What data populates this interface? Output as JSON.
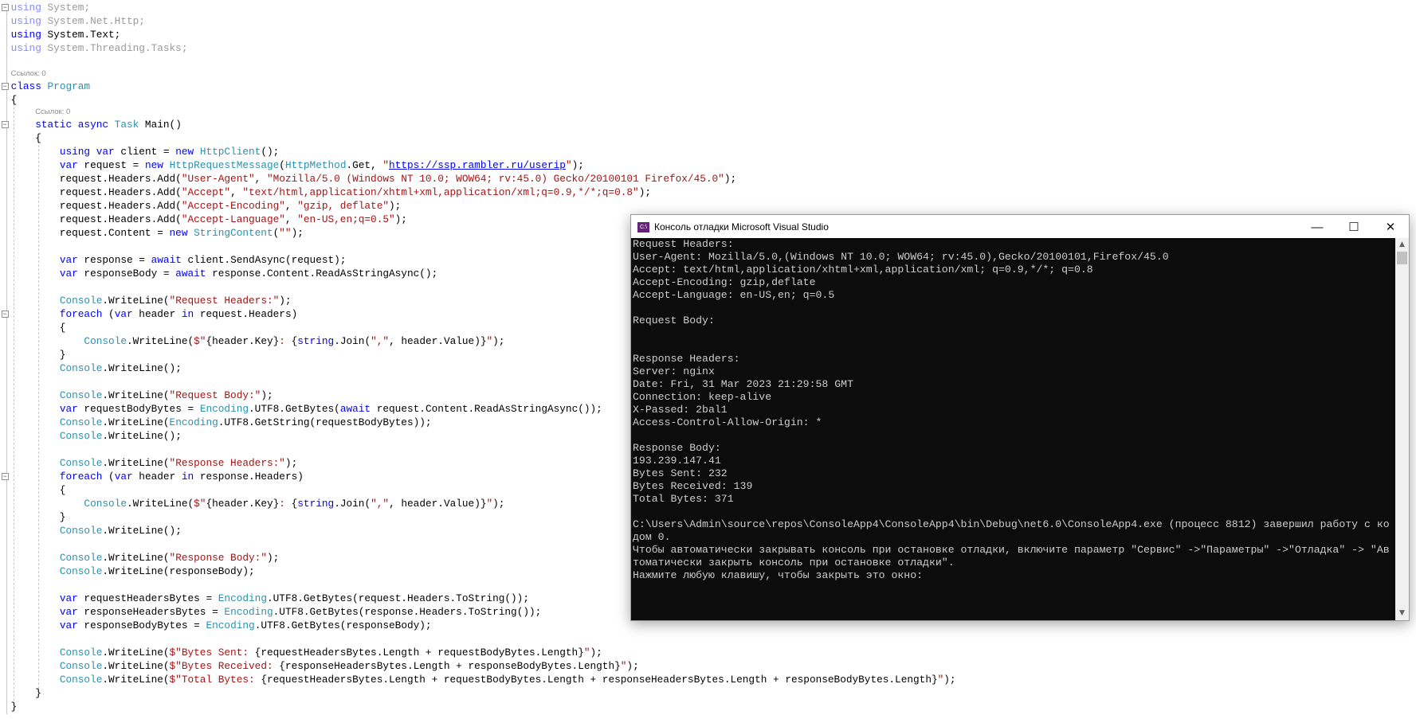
{
  "code": {
    "lines": [
      {
        "fold": true,
        "tokens": [
          [
            "fk",
            "using"
          ],
          [
            "f",
            " System;"
          ]
        ]
      },
      {
        "tokens": [
          [
            "fk",
            "using"
          ],
          [
            "f",
            " System.Net.Http;"
          ]
        ]
      },
      {
        "tokens": [
          [
            "k",
            "using"
          ],
          [
            "p",
            " System.Text;"
          ]
        ]
      },
      {
        "tokens": [
          [
            "fk",
            "using"
          ],
          [
            "f",
            " System.Threading.Tasks;"
          ]
        ]
      },
      {
        "tokens": []
      },
      {
        "lens": "Ссылок: 0",
        "indent": 0
      },
      {
        "fold": true,
        "tokens": [
          [
            "k",
            "class"
          ],
          [
            "p",
            " "
          ],
          [
            "t",
            "Program"
          ]
        ]
      },
      {
        "tokens": [
          [
            "p",
            "{"
          ]
        ]
      },
      {
        "lens": "Ссылок: 0",
        "indent": 4
      },
      {
        "fold": true,
        "tokens": [
          [
            "p",
            "    "
          ],
          [
            "k",
            "static async "
          ],
          [
            "t",
            "Task"
          ],
          [
            "p",
            " Main()"
          ]
        ]
      },
      {
        "tokens": [
          [
            "p",
            "    {"
          ]
        ]
      },
      {
        "tokens": [
          [
            "p",
            "        "
          ],
          [
            "k",
            "using var"
          ],
          [
            "p",
            " client = "
          ],
          [
            "k",
            "new "
          ],
          [
            "t",
            "HttpClient"
          ],
          [
            "p",
            "();"
          ]
        ]
      },
      {
        "tokens": [
          [
            "p",
            "        "
          ],
          [
            "k",
            "var"
          ],
          [
            "p",
            " request = "
          ],
          [
            "k",
            "new "
          ],
          [
            "t",
            "HttpRequestMessage"
          ],
          [
            "p",
            "("
          ],
          [
            "t",
            "HttpMethod"
          ],
          [
            "p",
            ".Get, "
          ],
          [
            "s",
            "\""
          ],
          [
            "u",
            "https://ssp.rambler.ru/userip"
          ],
          [
            "s",
            "\""
          ],
          [
            "p",
            ");"
          ]
        ]
      },
      {
        "tokens": [
          [
            "p",
            "        request.Headers.Add("
          ],
          [
            "s",
            "\"User-Agent\""
          ],
          [
            "p",
            ", "
          ],
          [
            "s",
            "\"Mozilla/5.0 (Windows NT 10.0; WOW64; rv:45.0) Gecko/20100101 Firefox/45.0\""
          ],
          [
            "p",
            ");"
          ]
        ]
      },
      {
        "tokens": [
          [
            "p",
            "        request.Headers.Add("
          ],
          [
            "s",
            "\"Accept\""
          ],
          [
            "p",
            ", "
          ],
          [
            "s",
            "\"text/html,application/xhtml+xml,application/xml;q=0.9,*/*;q=0.8\""
          ],
          [
            "p",
            ");"
          ]
        ]
      },
      {
        "tokens": [
          [
            "p",
            "        request.Headers.Add("
          ],
          [
            "s",
            "\"Accept-Encoding\""
          ],
          [
            "p",
            ", "
          ],
          [
            "s",
            "\"gzip, deflate\""
          ],
          [
            "p",
            ");"
          ]
        ]
      },
      {
        "tokens": [
          [
            "p",
            "        request.Headers.Add("
          ],
          [
            "s",
            "\"Accept-Language\""
          ],
          [
            "p",
            ", "
          ],
          [
            "s",
            "\"en-US,en;q=0.5\""
          ],
          [
            "p",
            ");"
          ]
        ]
      },
      {
        "tokens": [
          [
            "p",
            "        request.Content = "
          ],
          [
            "k",
            "new "
          ],
          [
            "t",
            "StringContent"
          ],
          [
            "p",
            "("
          ],
          [
            "s",
            "\"\""
          ],
          [
            "p",
            ");"
          ]
        ]
      },
      {
        "tokens": []
      },
      {
        "tokens": [
          [
            "p",
            "        "
          ],
          [
            "k",
            "var"
          ],
          [
            "p",
            " response = "
          ],
          [
            "k",
            "await"
          ],
          [
            "p",
            " client.SendAsync(request);"
          ]
        ]
      },
      {
        "tokens": [
          [
            "p",
            "        "
          ],
          [
            "k",
            "var"
          ],
          [
            "p",
            " responseBody = "
          ],
          [
            "k",
            "await"
          ],
          [
            "p",
            " response.Content.ReadAsStringAsync();"
          ]
        ]
      },
      {
        "tokens": []
      },
      {
        "tokens": [
          [
            "p",
            "        "
          ],
          [
            "t",
            "Console"
          ],
          [
            "p",
            ".WriteLine("
          ],
          [
            "s",
            "\"Request Headers:\""
          ],
          [
            "p",
            ");"
          ]
        ]
      },
      {
        "fold": true,
        "tokens": [
          [
            "p",
            "        "
          ],
          [
            "k",
            "foreach"
          ],
          [
            "p",
            " ("
          ],
          [
            "k",
            "var"
          ],
          [
            "p",
            " header "
          ],
          [
            "k",
            "in"
          ],
          [
            "p",
            " request.Headers)"
          ]
        ]
      },
      {
        "tokens": [
          [
            "p",
            "        {"
          ]
        ]
      },
      {
        "tokens": [
          [
            "p",
            "            "
          ],
          [
            "t",
            "Console"
          ],
          [
            "p",
            ".WriteLine("
          ],
          [
            "s",
            "$\""
          ],
          [
            "p",
            "{header.Key}"
          ],
          [
            "s",
            ": "
          ],
          [
            "p",
            "{"
          ],
          [
            "k",
            "string"
          ],
          [
            "p",
            ".Join("
          ],
          [
            "s",
            "\",\""
          ],
          [
            "p",
            ", header.Value)}"
          ],
          [
            "s",
            "\""
          ],
          [
            "p",
            ");"
          ]
        ]
      },
      {
        "tokens": [
          [
            "p",
            "        }"
          ]
        ]
      },
      {
        "tokens": [
          [
            "p",
            "        "
          ],
          [
            "t",
            "Console"
          ],
          [
            "p",
            ".WriteLine();"
          ]
        ]
      },
      {
        "tokens": []
      },
      {
        "tokens": [
          [
            "p",
            "        "
          ],
          [
            "t",
            "Console"
          ],
          [
            "p",
            ".WriteLine("
          ],
          [
            "s",
            "\"Request Body:\""
          ],
          [
            "p",
            ");"
          ]
        ]
      },
      {
        "tokens": [
          [
            "p",
            "        "
          ],
          [
            "k",
            "var"
          ],
          [
            "p",
            " requestBodyBytes = "
          ],
          [
            "t",
            "Encoding"
          ],
          [
            "p",
            ".UTF8.GetBytes("
          ],
          [
            "k",
            "await"
          ],
          [
            "p",
            " request.Content.ReadAsStringAsync());"
          ]
        ]
      },
      {
        "tokens": [
          [
            "p",
            "        "
          ],
          [
            "t",
            "Console"
          ],
          [
            "p",
            ".WriteLine("
          ],
          [
            "t",
            "Encoding"
          ],
          [
            "p",
            ".UTF8.GetString(requestBodyBytes));"
          ]
        ]
      },
      {
        "tokens": [
          [
            "p",
            "        "
          ],
          [
            "t",
            "Console"
          ],
          [
            "p",
            ".WriteLine();"
          ]
        ]
      },
      {
        "tokens": []
      },
      {
        "tokens": [
          [
            "p",
            "        "
          ],
          [
            "t",
            "Console"
          ],
          [
            "p",
            ".WriteLine("
          ],
          [
            "s",
            "\"Response Headers:\""
          ],
          [
            "p",
            ");"
          ]
        ]
      },
      {
        "fold": true,
        "tokens": [
          [
            "p",
            "        "
          ],
          [
            "k",
            "foreach"
          ],
          [
            "p",
            " ("
          ],
          [
            "k",
            "var"
          ],
          [
            "p",
            " header "
          ],
          [
            "k",
            "in"
          ],
          [
            "p",
            " response.Headers)"
          ]
        ]
      },
      {
        "tokens": [
          [
            "p",
            "        {"
          ]
        ]
      },
      {
        "tokens": [
          [
            "p",
            "            "
          ],
          [
            "t",
            "Console"
          ],
          [
            "p",
            ".WriteLine("
          ],
          [
            "s",
            "$\""
          ],
          [
            "p",
            "{header.Key}"
          ],
          [
            "s",
            ": "
          ],
          [
            "p",
            "{"
          ],
          [
            "k",
            "string"
          ],
          [
            "p",
            ".Join("
          ],
          [
            "s",
            "\",\""
          ],
          [
            "p",
            ", header.Value)}"
          ],
          [
            "s",
            "\""
          ],
          [
            "p",
            ");"
          ]
        ]
      },
      {
        "tokens": [
          [
            "p",
            "        }"
          ]
        ]
      },
      {
        "tokens": [
          [
            "p",
            "        "
          ],
          [
            "t",
            "Console"
          ],
          [
            "p",
            ".WriteLine();"
          ]
        ]
      },
      {
        "tokens": []
      },
      {
        "tokens": [
          [
            "p",
            "        "
          ],
          [
            "t",
            "Console"
          ],
          [
            "p",
            ".WriteLine("
          ],
          [
            "s",
            "\"Response Body:\""
          ],
          [
            "p",
            ");"
          ]
        ]
      },
      {
        "tokens": [
          [
            "p",
            "        "
          ],
          [
            "t",
            "Console"
          ],
          [
            "p",
            ".WriteLine(responseBody);"
          ]
        ]
      },
      {
        "tokens": []
      },
      {
        "tokens": [
          [
            "p",
            "        "
          ],
          [
            "k",
            "var"
          ],
          [
            "p",
            " requestHeadersBytes = "
          ],
          [
            "t",
            "Encoding"
          ],
          [
            "p",
            ".UTF8.GetBytes(request.Headers.ToString());"
          ]
        ]
      },
      {
        "tokens": [
          [
            "p",
            "        "
          ],
          [
            "k",
            "var"
          ],
          [
            "p",
            " responseHeadersBytes = "
          ],
          [
            "t",
            "Encoding"
          ],
          [
            "p",
            ".UTF8.GetBytes(response.Headers.ToString());"
          ]
        ]
      },
      {
        "tokens": [
          [
            "p",
            "        "
          ],
          [
            "k",
            "var"
          ],
          [
            "p",
            " responseBodyBytes = "
          ],
          [
            "t",
            "Encoding"
          ],
          [
            "p",
            ".UTF8.GetBytes(responseBody);"
          ]
        ]
      },
      {
        "tokens": []
      },
      {
        "tokens": [
          [
            "p",
            "        "
          ],
          [
            "t",
            "Console"
          ],
          [
            "p",
            ".WriteLine("
          ],
          [
            "s",
            "$\"Bytes Sent: "
          ],
          [
            "p",
            "{requestHeadersBytes.Length + requestBodyBytes.Length}"
          ],
          [
            "s",
            "\""
          ],
          [
            "p",
            ");"
          ]
        ]
      },
      {
        "tokens": [
          [
            "p",
            "        "
          ],
          [
            "t",
            "Console"
          ],
          [
            "p",
            ".WriteLine("
          ],
          [
            "s",
            "$\"Bytes Received: "
          ],
          [
            "p",
            "{responseHeadersBytes.Length + responseBodyBytes.Length}"
          ],
          [
            "s",
            "\""
          ],
          [
            "p",
            ");"
          ]
        ]
      },
      {
        "tokens": [
          [
            "p",
            "        "
          ],
          [
            "t",
            "Console"
          ],
          [
            "p",
            ".WriteLine("
          ],
          [
            "s",
            "$\"Total Bytes: "
          ],
          [
            "p",
            "{requestHeadersBytes.Length + requestBodyBytes.Length + responseHeadersBytes.Length + responseBodyBytes.Length}"
          ],
          [
            "s",
            "\""
          ],
          [
            "p",
            ");"
          ]
        ]
      },
      {
        "tokens": [
          [
            "p",
            "    }"
          ]
        ]
      },
      {
        "tokens": [
          [
            "p",
            "}"
          ]
        ]
      }
    ]
  },
  "console": {
    "title": "Консоль отладки Microsoft Visual Studio",
    "icon": "vs-console-icon",
    "buttons": {
      "minimize": "—",
      "maximize": "☐",
      "close": "✕"
    },
    "lines": [
      "Request Headers:",
      "User-Agent: Mozilla/5.0,(Windows NT 10.0; WOW64; rv:45.0),Gecko/20100101,Firefox/45.0",
      "Accept: text/html,application/xhtml+xml,application/xml; q=0.9,*/*; q=0.8",
      "Accept-Encoding: gzip,deflate",
      "Accept-Language: en-US,en; q=0.5",
      "",
      "Request Body:",
      "",
      "",
      "Response Headers:",
      "Server: nginx",
      "Date: Fri, 31 Mar 2023 21:29:58 GMT",
      "Connection: keep-alive",
      "X-Passed: 2bal1",
      "Access-Control-Allow-Origin: *",
      "",
      "Response Body:",
      "193.239.147.41",
      "Bytes Sent: 232",
      "Bytes Received: 139",
      "Total Bytes: 371",
      "",
      "C:\\Users\\Admin\\source\\repos\\ConsoleApp4\\ConsoleApp4\\bin\\Debug\\net6.0\\ConsoleApp4.exe (процесс 8812) завершил работу с ко",
      "дом 0.",
      "Чтобы автоматически закрывать консоль при остановке отладки, включите параметр \"Сервис\" ->\"Параметры\" ->\"Отладка\" -> \"Ав",
      "томатически закрыть консоль при остановке отладки\".",
      "Нажмите любую клавишу, чтобы закрыть это окно:"
    ]
  },
  "colors": {
    "keyword": "#0000ff",
    "type": "#2b91af",
    "string": "#a31515",
    "console_bg": "#0c0c0c",
    "console_fg": "#cccccc"
  }
}
